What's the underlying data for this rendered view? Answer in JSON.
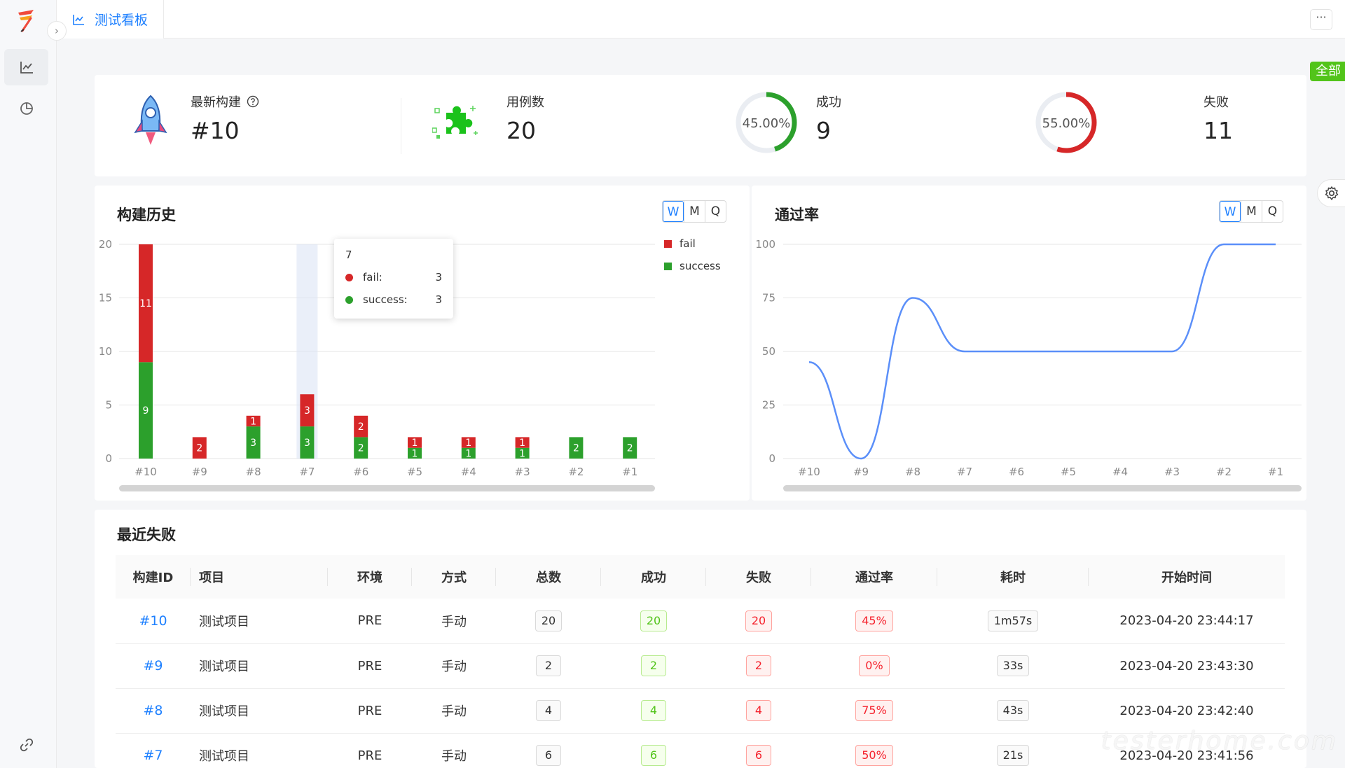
{
  "app": {
    "tab_title": "测试看板",
    "more_label": "···",
    "all_badge": "全部"
  },
  "stats": {
    "latest_build": {
      "label": "最新构建",
      "value": "#10"
    },
    "cases": {
      "label": "用例数",
      "value": "20"
    },
    "success": {
      "label": "成功",
      "value": "9",
      "percent_text": "45.00%",
      "percent": 45
    },
    "fail": {
      "label": "失败",
      "value": "11",
      "percent_text": "55.00%",
      "percent": 55
    }
  },
  "build_history": {
    "title": "构建历史",
    "periods": [
      "W",
      "M",
      "Q"
    ],
    "active_period": "W",
    "tooltip": {
      "title": "7",
      "fail_label": "fail:",
      "fail_value": "3",
      "success_label": "success:",
      "success_value": "3"
    }
  },
  "pass_rate": {
    "title": "通过率",
    "periods": [
      "W",
      "M",
      "Q"
    ],
    "active_period": "W"
  },
  "chart_data": [
    {
      "type": "bar",
      "stacked": true,
      "categories": [
        "#10",
        "#9",
        "#8",
        "#7",
        "#6",
        "#5",
        "#4",
        "#3",
        "#2",
        "#1"
      ],
      "series": [
        {
          "name": "success",
          "color": "#2ca02c",
          "values": [
            9,
            0,
            3,
            3,
            2,
            1,
            1,
            1,
            2,
            2
          ]
        },
        {
          "name": "fail",
          "color": "#d62728",
          "values": [
            11,
            2,
            1,
            3,
            2,
            1,
            1,
            1,
            0,
            0
          ]
        }
      ],
      "yticks": [
        0,
        5,
        10,
        15,
        20
      ],
      "ylim": [
        0,
        20
      ],
      "legend": "top-right",
      "grid": true
    },
    {
      "type": "line",
      "categories": [
        "#10",
        "#9",
        "#8",
        "#7",
        "#6",
        "#5",
        "#4",
        "#3",
        "#2",
        "#1"
      ],
      "series": [
        {
          "color": "#5b8ff9",
          "values": [
            45,
            0,
            75,
            50,
            50,
            50,
            50,
            50,
            100,
            100
          ]
        }
      ],
      "yticks": [
        0,
        25,
        50,
        75,
        100
      ],
      "ylim": [
        0,
        100
      ],
      "grid": true,
      "smooth": true
    }
  ],
  "recent_failures": {
    "title": "最近失败",
    "columns": [
      "构建ID",
      "项目",
      "环境",
      "方式",
      "总数",
      "成功",
      "失败",
      "通过率",
      "耗时",
      "开始时间"
    ],
    "rows": [
      {
        "id": "#10",
        "project": "测试项目",
        "env": "PRE",
        "mode": "手动",
        "total": "20",
        "success": "20",
        "fail": "20",
        "rate": "45%",
        "duration": "1m57s",
        "start": "2023-04-20 23:44:17"
      },
      {
        "id": "#9",
        "project": "测试项目",
        "env": "PRE",
        "mode": "手动",
        "total": "2",
        "success": "2",
        "fail": "2",
        "rate": "0%",
        "duration": "33s",
        "start": "2023-04-20 23:43:30"
      },
      {
        "id": "#8",
        "project": "测试项目",
        "env": "PRE",
        "mode": "手动",
        "total": "4",
        "success": "4",
        "fail": "4",
        "rate": "75%",
        "duration": "43s",
        "start": "2023-04-20 23:42:40"
      },
      {
        "id": "#7",
        "project": "测试项目",
        "env": "PRE",
        "mode": "手动",
        "total": "6",
        "success": "6",
        "fail": "6",
        "rate": "50%",
        "duration": "21s",
        "start": "2023-04-20 23:41:56"
      }
    ]
  },
  "watermark": "testerhome.com"
}
